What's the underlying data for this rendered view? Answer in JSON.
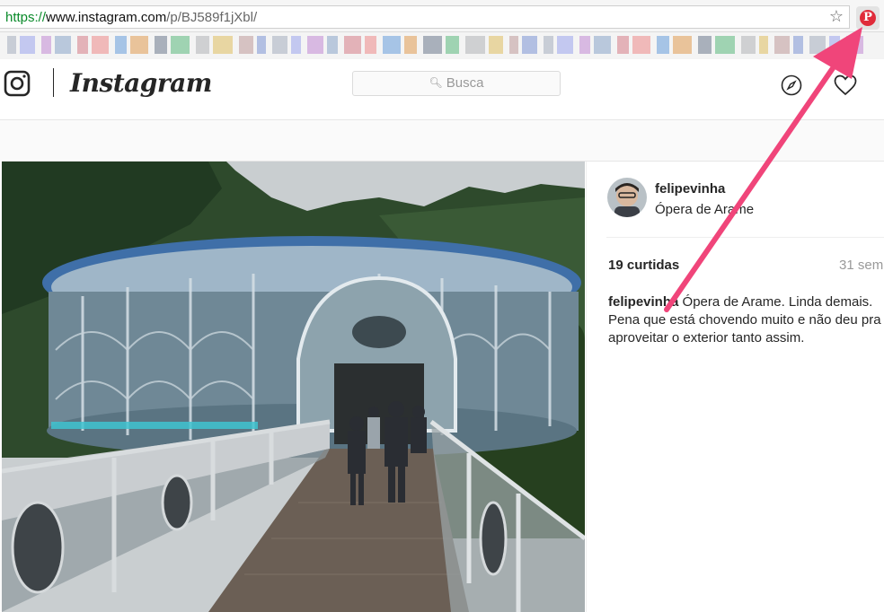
{
  "browser": {
    "url_scheme": "https://",
    "url_host": "www.instagram.com",
    "url_path": "/p/BJ589f1jXbl/",
    "bookmark_icon": "star-icon",
    "extension_icon": "pinterest-icon",
    "extension_glyph": "P",
    "bookmark_bar_blurred": true
  },
  "header": {
    "wordmark": "Instagram",
    "search_placeholder": "Busca",
    "icons": [
      "instagram-camera-icon",
      "compass-icon",
      "heart-icon"
    ]
  },
  "post": {
    "username": "felipevinha",
    "location": "Ópera de Arame",
    "likes": "19 curtidas",
    "time": "31 sem",
    "caption_user": "felipevinha",
    "caption_text": "Ópera de Arame. Linda demais. Pena que está chovendo muito e não deu pra aproveitar o exterior tanto assim."
  },
  "colors": {
    "accent_arrow": "#f0457a",
    "pinterest_red": "#e02b3a",
    "url_green": "#0a8a2a"
  }
}
